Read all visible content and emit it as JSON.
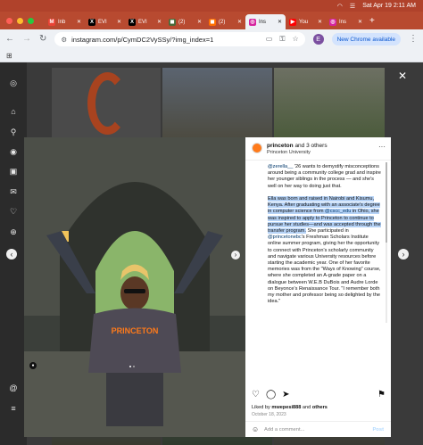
{
  "menubar": {
    "date_time": "Sat Apr 19  2:11 AM"
  },
  "tabs": [
    {
      "label": "Inb",
      "icon": "gmail-icon",
      "color": "#ea4335",
      "glyph": "M"
    },
    {
      "label": "EVI",
      "icon": "x-icon",
      "color": "#000000",
      "glyph": "X"
    },
    {
      "label": "EVI",
      "icon": "x-icon",
      "color": "#000000",
      "glyph": "X"
    },
    {
      "label": "(2)",
      "icon": "app-icon",
      "color": "#4a6b3a",
      "glyph": "◼"
    },
    {
      "label": "(2)",
      "icon": "app-icon",
      "color": "#ff6f00",
      "glyph": "◼"
    },
    {
      "label": "Ins",
      "icon": "instagram-icon",
      "color": "#d6249f",
      "glyph": "◎"
    },
    {
      "label": "You",
      "icon": "youtube-icon",
      "color": "#ff0000",
      "glyph": "▶"
    },
    {
      "label": "Ins",
      "icon": "instagram-icon",
      "color": "#d6249f",
      "glyph": "◎"
    }
  ],
  "toolbar": {
    "url": "instagram.com/p/CymDC2VySSy/?img_index=1",
    "profile_letter": "E",
    "new_chrome": "New Chrome available"
  },
  "post": {
    "account": "princeton",
    "and_others": "and 3 others",
    "subtitle": "Princeton University",
    "caption_intro_handle": "@zerella__",
    "caption_intro": " '26 wants to demystify misconceptions around being a community college grad and inspire her younger siblings in the process — and she's well on her way to doing just that.",
    "caption_highlight_1": "Ella was born and raised in Nairobi and Kisumu, Kenya. After graduating with an associate's degree in computer science from ",
    "caption_highlight_handle": "@cscc_edu",
    "caption_highlight_2": " in Ohio, she was inspired to apply to Princeton to continue to pursue her studies—and was accepted through the transfer program.",
    "caption_rest_1": " She participated in ",
    "caption_rest_handle": "@princetonebc",
    "caption_rest_2": "'s Freshman Scholars Institute online summer program, giving her the opportunity to connect with Princeton's scholarly community and navigate various University resources before starting the academic year. One of her favorite memories was from the \"Ways of Knowing\" course, where she completed an A-grade paper on a dialogue between W.E.B DuBois and Audre Lorde on Beyonce's Renaissance Tour. \"I remember both my mother and professor being so delighted by the idea.\"",
    "liked_prefix": "Liked by ",
    "liked_user": "mwepesi888",
    "liked_suffix": " and ",
    "liked_others": "others",
    "date": "October 18, 2023",
    "comment_placeholder": "Add a comment...",
    "post_button": "Post",
    "shirt_text": "PRINCETON"
  }
}
